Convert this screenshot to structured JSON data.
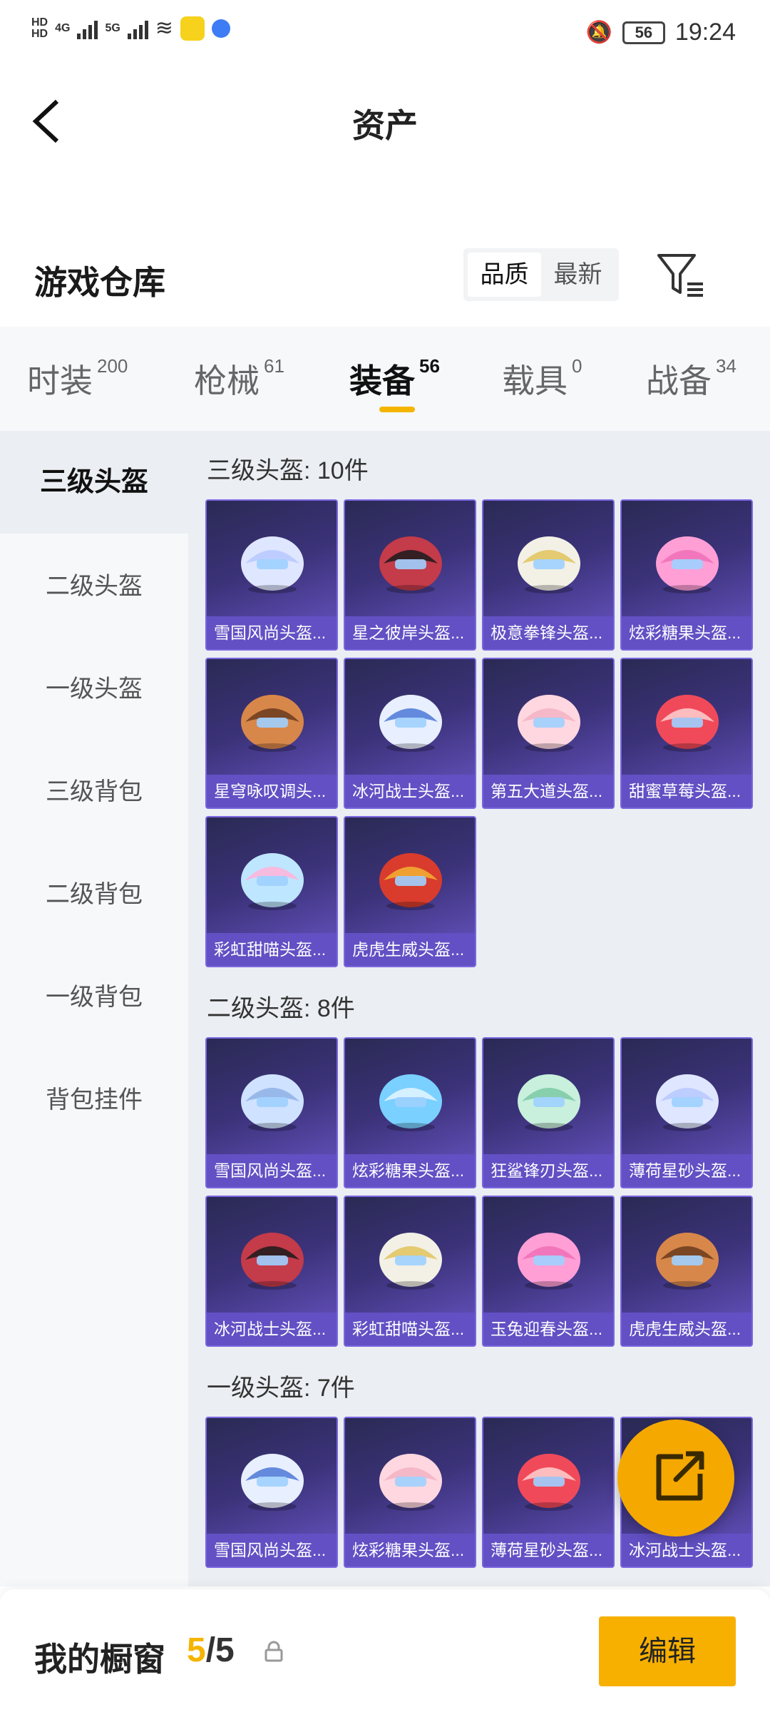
{
  "status_bar": {
    "net1": "4G",
    "net2": "5G",
    "battery": "56",
    "time": "19:24"
  },
  "header": {
    "title": "资产"
  },
  "warehouse": {
    "title": "游戏仓库",
    "sort_options": [
      "品质",
      "最新"
    ],
    "sort_active": "品质"
  },
  "tabs": [
    {
      "label": "时装",
      "count": "200"
    },
    {
      "label": "枪械",
      "count": "61"
    },
    {
      "label": "装备",
      "count": "56"
    },
    {
      "label": "载具",
      "count": "0"
    },
    {
      "label": "战备",
      "count": "34"
    }
  ],
  "categories": [
    "三级头盔",
    "二级头盔",
    "一级头盔",
    "三级背包",
    "二级背包",
    "一级背包",
    "背包挂件"
  ],
  "sections": [
    {
      "title": "三级头盔: 10件",
      "items": [
        "雪国风尚头盔...",
        "星之彼岸头盔...",
        "极意拳锋头盔...",
        "炫彩糖果头盔...",
        "星穹咏叹调头...",
        "冰河战士头盔...",
        "第五大道头盔...",
        "甜蜜草莓头盔...",
        "彩虹甜喵头盔...",
        "虎虎生威头盔..."
      ]
    },
    {
      "title": "二级头盔: 8件",
      "items": [
        "雪国风尚头盔...",
        "炫彩糖果头盔...",
        "狂鲨锋刃头盔...",
        "薄荷星砂头盔...",
        "冰河战士头盔...",
        "彩虹甜喵头盔...",
        "玉兔迎春头盔...",
        "虎虎生威头盔..."
      ]
    },
    {
      "title": "一级头盔: 7件",
      "items": [
        "雪国风尚头盔...",
        "炫彩糖果头盔...",
        "薄荷星砂头盔...",
        "冰河战士头盔..."
      ]
    }
  ],
  "bottom": {
    "title": "我的橱窗",
    "count_current": "5",
    "count_sep": "/",
    "count_total": "5",
    "edit_label": "编辑"
  },
  "colors": {
    "accent": "#f5b400",
    "card_label": "#6250c4"
  }
}
